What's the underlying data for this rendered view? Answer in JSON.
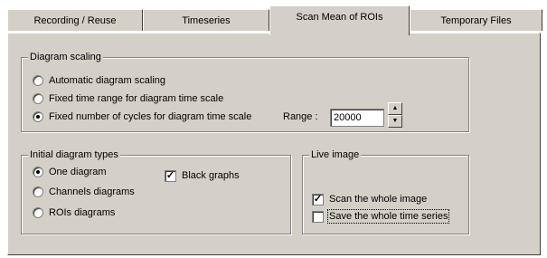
{
  "tabs": [
    {
      "label": "Recording / Reuse",
      "active": false
    },
    {
      "label": "Timeseries",
      "active": false
    },
    {
      "label": "Scan Mean of ROIs",
      "active": true
    },
    {
      "label": "Temporary Files",
      "active": false
    }
  ],
  "diagram_scaling": {
    "legend": "Diagram scaling",
    "options": [
      {
        "label": "Automatic diagram scaling",
        "selected": false
      },
      {
        "label": "Fixed time range for diagram time scale",
        "selected": false
      },
      {
        "label": "Fixed number of cycles for diagram time scale",
        "selected": true
      }
    ],
    "range_label": "Range :",
    "range_value": "20000",
    "spin_up": "up-arrow-icon",
    "spin_down": "down-arrow-icon"
  },
  "initial_types": {
    "legend": "Initial diagram types",
    "options": [
      {
        "label": "One diagram",
        "selected": true
      },
      {
        "label": "Channels diagrams",
        "selected": false
      },
      {
        "label": "ROIs diagrams",
        "selected": false
      }
    ],
    "black_graphs": {
      "label": "Black graphs",
      "checked": true
    }
  },
  "live_image": {
    "legend": "Live image",
    "scan_whole": {
      "label": "Scan the whole image",
      "checked": true
    },
    "save_whole": {
      "label": "Save the whole time series",
      "checked": false
    }
  }
}
